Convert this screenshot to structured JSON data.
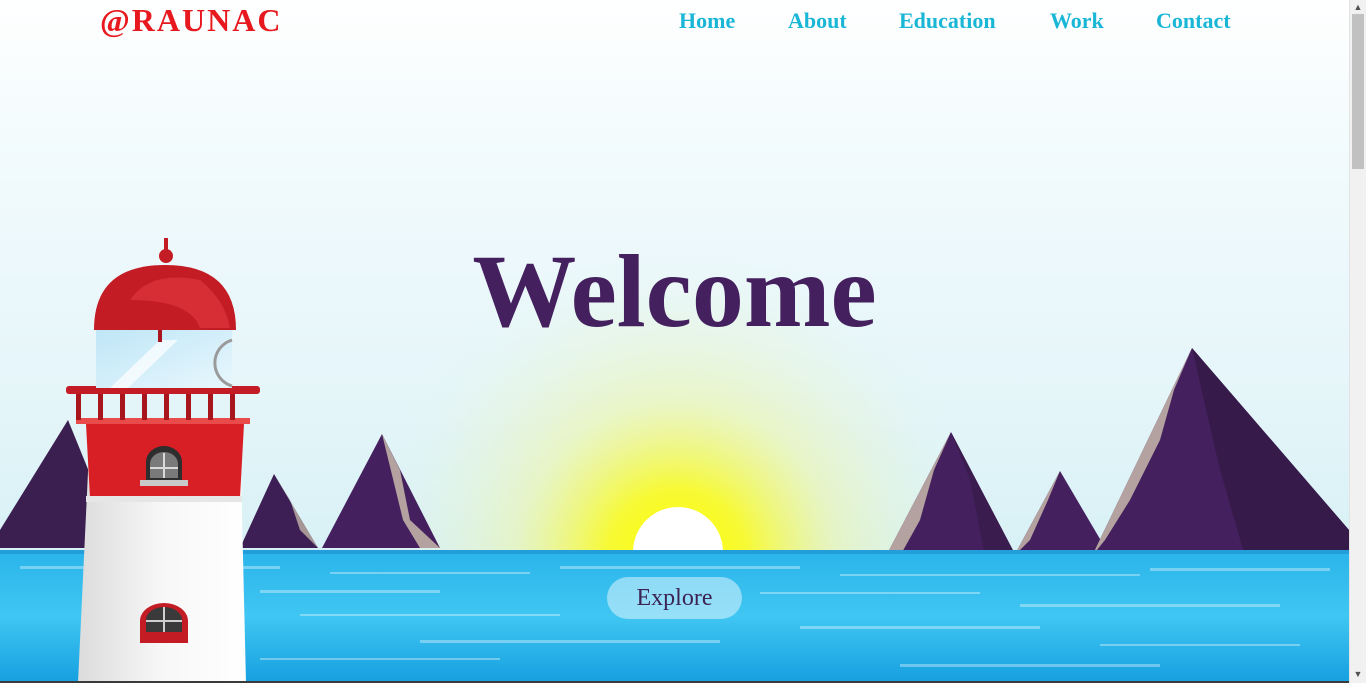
{
  "nav": {
    "brand": "@RAUNAC",
    "links": [
      "Home",
      "About",
      "Education",
      "Work",
      "Contact"
    ]
  },
  "hero": {
    "title": "Welcome",
    "button_label": "Explore"
  },
  "colors": {
    "brand": "#e8191e",
    "nav_link": "#1ab6d6",
    "title": "#45205e",
    "mountain": "#45205e",
    "sea": "#1eb2ea",
    "lighthouse_red": "#d81f26"
  },
  "scrollbar": {
    "up_icon": "arrow-up-icon",
    "down_icon": "arrow-down-icon"
  }
}
